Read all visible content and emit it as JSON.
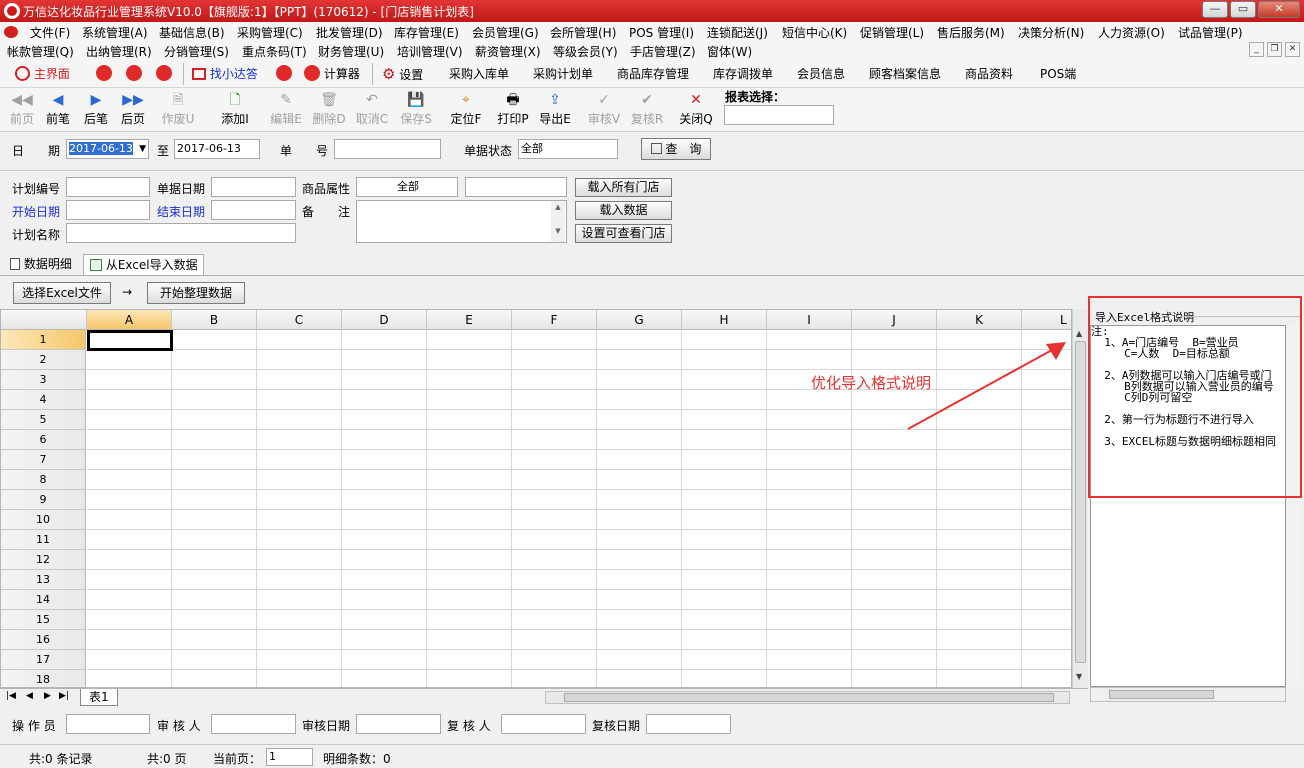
{
  "window": {
    "title": "万信达化妆品行业管理系统V10.0【旗舰版:1】【PPT】(170612) - [门店销售计划表]",
    "min": "—",
    "max": "▭",
    "close": "✕"
  },
  "menu_row1": [
    "文件(F)",
    "系统管理(A)",
    "基础信息(B)",
    "采购管理(C)",
    "批发管理(D)",
    "库存管理(E)",
    "会员管理(G)",
    "会所管理(H)",
    "POS 管理(I)",
    "连锁配送(J)",
    "短信中心(K)",
    "促销管理(L)",
    "售后服务(M)",
    "决策分析(N)",
    "人力资源(O)",
    "试品管理(P)"
  ],
  "menu_row2": [
    "帐款管理(Q)",
    "出纳管理(R)",
    "分销管理(S)",
    "重点条码(T)",
    "财务管理(U)",
    "培训管理(V)",
    "薪资管理(X)",
    "等级会员(Y)",
    "手店管理(Z)",
    "窗体(W)"
  ],
  "mdi": {
    "min": "_",
    "restore": "❐",
    "close": "✕"
  },
  "nav": {
    "home": "主界面",
    "find": "找小达答",
    "calc": "计算器",
    "settings": "设置",
    "links": [
      "采购入库单",
      "采购计划单",
      "商品库存管理",
      "库存调拨单",
      "会员信息",
      "顾客档案信息",
      "商品资料",
      "POS端"
    ]
  },
  "toolbar": {
    "buttons": [
      {
        "label": "前页",
        "icon": "◀◀",
        "enabled": false
      },
      {
        "label": "前笔",
        "icon": "◀",
        "enabled": true
      },
      {
        "label": "后笔",
        "icon": "▶",
        "enabled": true
      },
      {
        "label": "后页",
        "icon": "▶▶",
        "enabled": true
      },
      {
        "label": "作废U",
        "icon": "🗎",
        "enabled": false
      },
      {
        "label": "添加I",
        "icon": "🗋",
        "enabled": true
      },
      {
        "label": "编辑E",
        "icon": "✎",
        "enabled": false
      },
      {
        "label": "删除D",
        "icon": "🗑",
        "enabled": false
      },
      {
        "label": "取消C",
        "icon": "↶",
        "enabled": false
      },
      {
        "label": "保存S",
        "icon": "💾",
        "enabled": false
      },
      {
        "label": "定位F",
        "icon": "⌖",
        "enabled": true
      },
      {
        "label": "打印P",
        "icon": "🖶",
        "enabled": true
      },
      {
        "label": "导出E",
        "icon": "⇪",
        "enabled": true
      },
      {
        "label": "审核V",
        "icon": "✓",
        "enabled": false
      },
      {
        "label": "复核R",
        "icon": "✔",
        "enabled": false
      },
      {
        "label": "关闭Q",
        "icon": "✕",
        "enabled": true
      }
    ],
    "report_label": "报表选择：",
    "report_value": ""
  },
  "query": {
    "date_label": "日　　期",
    "date_from": "2017-06-13",
    "to_label": "至",
    "date_to": "2017-06-13",
    "docno_label": "单　　号",
    "docno": "",
    "status_label": "单据状态",
    "status": "全部",
    "query_btn": "查　询"
  },
  "form": {
    "plan_no_label": "计划编号",
    "plan_no": "",
    "doc_date_label": "单据日期",
    "doc_date": "",
    "attr_label": "商品属性",
    "attr_value": "全部",
    "attr_extra": "",
    "load_all_btn": "载入所有门店",
    "start_label": "开始日期",
    "start": "",
    "end_label": "结束日期",
    "end": "",
    "remark_label": "备　　注",
    "remark": "",
    "load_data_btn": "载入数据",
    "plan_name_label": "计划名称",
    "plan_name": "",
    "set_visible_btn": "设置可查看门店"
  },
  "tabs": [
    "数据明细",
    "从Excel导入数据"
  ],
  "excel": {
    "select_btn": "选择Excel文件",
    "arrow": "→",
    "start_btn": "开始整理数据"
  },
  "grid": {
    "columns": [
      "A",
      "B",
      "C",
      "D",
      "E",
      "F",
      "G",
      "H",
      "I",
      "J",
      "K",
      "L"
    ],
    "rows": [
      "1",
      "2",
      "3",
      "4",
      "5",
      "6",
      "7",
      "8",
      "9",
      "10",
      "11",
      "12",
      "13",
      "14",
      "15",
      "16",
      "17",
      "18"
    ],
    "sheet_tab": "表1"
  },
  "panel": {
    "title": "导入Excel格式说明",
    "text": "注:\n  1、A=门店编号  B=营业员\n     C=人数  D=目标总额\n\n  2、A列数据可以输入门店编号或门\n     B列数据可以输入营业员的编号\n     C列D列可留空\n\n  2、第一行为标题行不进行导入\n\n  3、EXCEL标题与数据明细标题相同"
  },
  "annotation": "优化导入格式说明",
  "footer": {
    "operator_label": "操 作 员",
    "operator": "",
    "auditor_label": "审 核 人",
    "auditor": "",
    "audit_date_label": "审核日期",
    "audit_date": "",
    "reviewer_label": "复 核 人",
    "reviewer": "",
    "review_date_label": "复核日期",
    "review_date": ""
  },
  "status": {
    "records": "共:0 条记录",
    "pages": "共:0 页",
    "current_label": "当前页：",
    "current": "1",
    "detail_count": "明细条数：0"
  },
  "colors": {
    "title_bar": "#d42020",
    "annotation": "#e53333",
    "link_blue": "#1a2fd0"
  }
}
